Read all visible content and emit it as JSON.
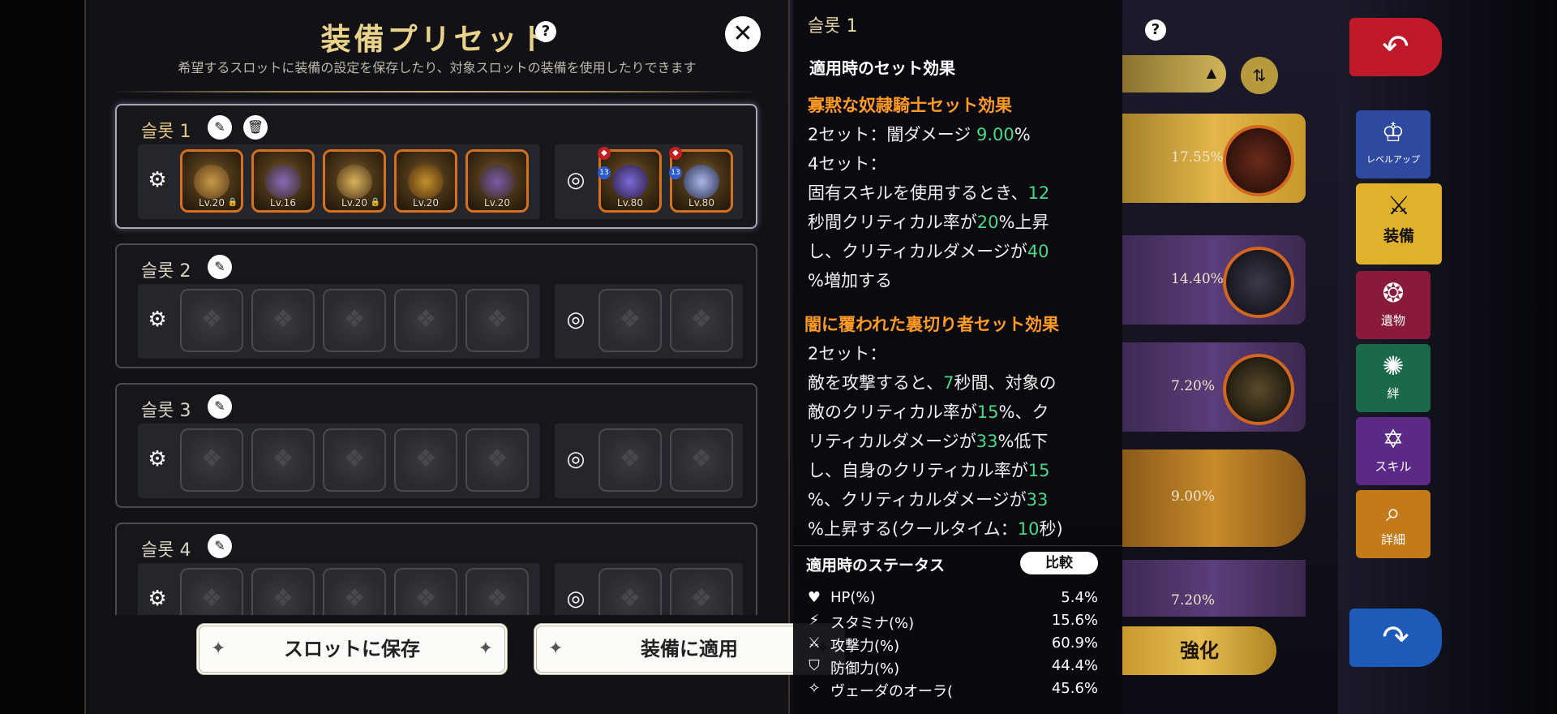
{
  "modal": {
    "title": "装備プリセット",
    "help_label": "?",
    "close_label": "✕",
    "subtitle": "希望するスロットに装備の設定を保存したり、対象スロットの装備を使用したりできます"
  },
  "slots": [
    {
      "name": "슬롯 1",
      "equipment": [
        {
          "level": "Lv.20",
          "locked": true
        },
        {
          "level": "Lv.16",
          "locked": false
        },
        {
          "level": "Lv.20",
          "locked": true
        },
        {
          "level": "Lv.20",
          "locked": false
        },
        {
          "level": "Lv.20",
          "locked": false
        }
      ],
      "accessories": [
        {
          "level": "Lv.80",
          "badge": "13"
        },
        {
          "level": "Lv.80",
          "badge": "13"
        }
      ]
    },
    {
      "name": "슬롯 2"
    },
    {
      "name": "슬롯 3"
    },
    {
      "name": "슬롯 4"
    }
  ],
  "buttons": {
    "save": "スロットに保存",
    "apply": "装備に適用",
    "compare": "比較",
    "enhance": "強化"
  },
  "tooltip": {
    "title": "슬롯 1",
    "section_title": "適用時のセット効果",
    "set1": {
      "name": "寡黙な奴隷騎士セット効果",
      "two_prefix": "2セット：闇ダメージ",
      "two_value": "9.00",
      "two_suffix": "%",
      "four_label": "4セット：",
      "l1_pre": "固有スキルを使用するとき、",
      "l1_val": "12",
      "l2_pre": "秒間クリティカル率が",
      "l2_val": "20",
      "l2_suf": "%上昇",
      "l3_pre": "し、クリティカルダメージが",
      "l3_val": "40",
      "l4": "%増加する"
    },
    "set2": {
      "name": "闇に覆われた裏切り者セット効果",
      "two_label": "2セット：",
      "l1_pre": "敵を攻撃すると、",
      "l1_val": "7",
      "l1_suf": "秒間、対象の",
      "l2_pre": "敵のクリティカル率が",
      "l2_val": "15",
      "l2_suf": "%、ク",
      "l3_pre": "リティカルダメージが",
      "l3_val": "33",
      "l3_suf": "%低下",
      "l4_pre": "し、自身のクリティカル率が",
      "l4_val": "15",
      "l5_pre": "%、クリティカルダメージが",
      "l5_val": "33",
      "l6_pre": "%上昇する(クールタイム：",
      "l6_val": "10",
      "l6_suf": "秒)"
    },
    "status_title": "適用時のステータス",
    "stats": [
      {
        "icon": "heart-icon",
        "label": "HP(%)",
        "value": "5.4%"
      },
      {
        "icon": "bolt-icon",
        "label": "スタミナ(%)",
        "value": "15.6%"
      },
      {
        "icon": "sword-icon",
        "label": "攻撃力(%)",
        "value": "60.9%"
      },
      {
        "icon": "shield-icon",
        "label": "防御力(%)",
        "value": "44.4%"
      },
      {
        "icon": "aura-icon",
        "label": "ヴェーダのオーラ(%)",
        "value": "45.6%"
      }
    ]
  },
  "right_list": [
    {
      "percent": "17.55%"
    },
    {
      "percent": "14.40%"
    },
    {
      "percent": "7.20%"
    },
    {
      "percent": "9.00%"
    },
    {
      "percent": "7.20%"
    }
  ],
  "side_tabs": {
    "levelup": "レベルアップ",
    "equip": "装備",
    "relic": "遺物",
    "bond": "絆",
    "skill": "スキル",
    "detail": "詳細"
  },
  "colors": {
    "title_gold": "#e9d28a",
    "highlight_orange": "#ff9a24",
    "value_green": "#48d88a",
    "item_border": "#d4701e"
  }
}
